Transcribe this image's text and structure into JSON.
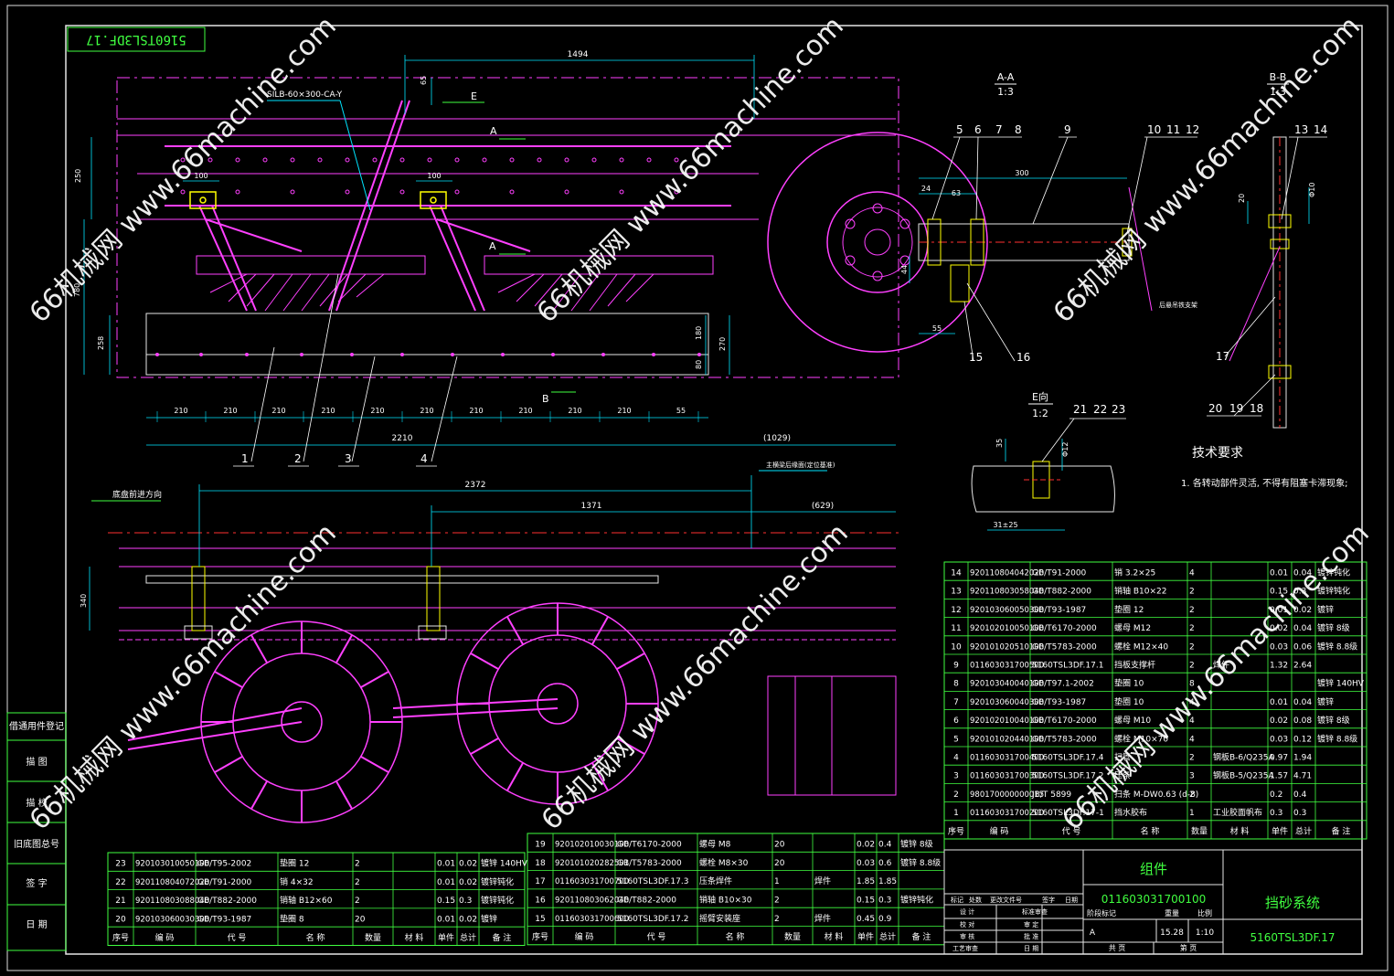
{
  "drawing_code_rotated": "5160TSL3DF.17",
  "dimensions": {
    "d1494": "1494",
    "d65": "65",
    "d250": "250",
    "d780": "780",
    "d258": "258",
    "d100a": "100",
    "d100b": "100",
    "d180": "180",
    "d270": "270",
    "d80": "80",
    "d210": "210",
    "d55": "55",
    "d2210": "2210",
    "d1029": "(1029)",
    "d2372": "2372",
    "d1371": "1371",
    "d629": "(629)",
    "d340": "340",
    "d300": "300",
    "d24": "24",
    "d63": "63",
    "d20": "20",
    "d10": "Φ10",
    "d44": "44",
    "d55b": "55",
    "d35": "35",
    "d12": "Φ12",
    "d31": "31±25"
  },
  "labels": {
    "part_code": "SILB-60×300-CA-Y",
    "E": "E",
    "A": "A",
    "A2": "A",
    "B": "B",
    "chassis_dir": "底盘前进方向",
    "frame_note": "主横梁后缘面(定位基准)",
    "support_note": "后悬吊铁支架"
  },
  "callouts": [
    "1",
    "2",
    "3",
    "4",
    "5",
    "6",
    "7",
    "8",
    "9",
    "10",
    "11",
    "12",
    "13",
    "14",
    "15",
    "16",
    "17",
    "18",
    "19",
    "20",
    "21",
    "22",
    "23"
  ],
  "views": {
    "aa_title": "A-A",
    "aa_scale": "1:3",
    "bb_title": "B-B",
    "bb_scale": "1:3",
    "e_title": "E向",
    "e_scale": "1:2"
  },
  "tech": {
    "title": "技术要求",
    "note1": "1. 各转动部件灵活, 不得有阻塞卡滞现象;"
  },
  "left_strip": [
    "借通用件登记",
    "描 图",
    "描 校",
    "旧底图总号",
    "签 字",
    "日 期"
  ],
  "bom_headers": {
    "seq": "序号",
    "code": "编 码",
    "std": "代 号",
    "name": "名 称",
    "qty": "数量",
    "mat": "材 料",
    "unit_w": "单件",
    "total_w": "总计",
    "weight": "重 量",
    "note": "备 注"
  },
  "bom_right": [
    [
      "14",
      "920110804042020",
      "GB/T91-2000",
      "销 3.2×25",
      "4",
      "",
      "0.01",
      "0.04",
      "镀锌钝化"
    ],
    [
      "13",
      "920110803058040",
      "GB/T882-2000",
      "销轴 B10×22",
      "2",
      "",
      "0.15",
      "0.3",
      "镀锌钝化"
    ],
    [
      "12",
      "920103060050300",
      "GB/T93-1987",
      "垫圈 12",
      "2",
      "",
      "0.01",
      "0.02",
      "镀锌"
    ],
    [
      "11",
      "920102010050100",
      "GB/T6170-2000",
      "螺母 M12",
      "2",
      "",
      "0.02",
      "0.04",
      "镀锌 8级"
    ],
    [
      "10",
      "920101020510100",
      "GB/T5783-2000",
      "螺栓 M12×40",
      "2",
      "",
      "0.03",
      "0.06",
      "镀锌 8.8级"
    ],
    [
      "9",
      "011603031700500",
      "5160TSL3DF.17.1",
      "挡板支撑杆",
      "2",
      "焊件",
      "1.32",
      "2.64",
      ""
    ],
    [
      "8",
      "920103040040100",
      "GB/T97.1-2002",
      "垫圈 10",
      "8",
      "",
      "",
      "",
      "镀锌 140HV"
    ],
    [
      "7",
      "920103060040300",
      "GB/T93-1987",
      "垫圈 10",
      "4",
      "",
      "0.01",
      "0.04",
      "镀锌"
    ],
    [
      "6",
      "920102010040100",
      "GB/T6170-2000",
      "螺母 M10",
      "4",
      "",
      "0.02",
      "0.08",
      "镀锌 8级"
    ],
    [
      "5",
      "920101020440100",
      "GB/T5783-2000",
      "螺栓 M10×70",
      "4",
      "",
      "0.03",
      "0.12",
      "镀锌 8.8级"
    ],
    [
      "4",
      "011603031700400",
      "5160TSL3DF.17.4",
      "扫管",
      "2",
      "钢板B-6/Q235A",
      "0.97",
      "1.94",
      ""
    ],
    [
      "3",
      "011603031700300",
      "5160TSL3DF.17.2",
      "压条",
      "3",
      "钢板B-5/Q235A",
      "1.57",
      "4.71",
      ""
    ],
    [
      "2",
      "980170000000015",
      "JB/T 5899",
      "扫条 M-DW0.63 (d-8)",
      "2",
      "",
      "0.2",
      "0.4",
      ""
    ],
    [
      "1",
      "011603031700200",
      "5160TSL3DF.17-1",
      "挡水胶布",
      "1",
      "工业胶面帆布",
      "0.3",
      "0.3",
      ""
    ]
  ],
  "bom_left": [
    [
      "23",
      "920103010050100",
      "GB/T95-2002",
      "垫圈 12",
      "2",
      "",
      "0.01",
      "0.02",
      "镀锌 140HV"
    ],
    [
      "22",
      "920110804072020",
      "GB/T91-2000",
      "销 4×32",
      "2",
      "",
      "0.01",
      "0.02",
      "镀锌钝化"
    ],
    [
      "21",
      "920110803088040",
      "GB/T882-2000",
      "销轴 B12×60",
      "2",
      "",
      "0.15",
      "0.3",
      "镀锌钝化"
    ],
    [
      "20",
      "920103060030300",
      "GB/T93-1987",
      "垫圈 8",
      "20",
      "",
      "0.01",
      "0.02",
      "镀锌"
    ]
  ],
  "bom_mid": [
    [
      "19",
      "920102010030100",
      "GB/T6170-2000",
      "螺母 M8",
      "20",
      "",
      "0.02",
      "0.4",
      "镀锌 8级"
    ],
    [
      "18",
      "920101020282501",
      "GB/T5783-2000",
      "螺栓 M8×30",
      "20",
      "",
      "0.03",
      "0.6",
      "镀锌 8.8级"
    ],
    [
      "17",
      "011603031700700",
      "5160TSL3DF.17.3",
      "压条焊件",
      "1",
      "焊件",
      "1.85",
      "1.85",
      ""
    ],
    [
      "16",
      "920110803062040",
      "GB/T882-2000",
      "销轴 B10×30",
      "2",
      "",
      "0.15",
      "0.3",
      "镀锌钝化"
    ],
    [
      "15",
      "011603031700600",
      "5160TSL3DF.17.2",
      "摇臂安装座",
      "2",
      "焊件",
      "0.45",
      "0.9",
      ""
    ]
  ],
  "title_block": {
    "assembly": "组件",
    "code": "011603031700100",
    "name": "挡砂系统",
    "drawing_no": "5160TSL3DF.17",
    "weight": "15.28",
    "scale": "1:10",
    "stage": "A",
    "rows": [
      "标记",
      "处数",
      "更改文件号",
      "签字",
      "日期"
    ],
    "sign": [
      "设 计",
      "校 对",
      "审 核",
      "工艺审查"
    ],
    "sign2": [
      "标准审查",
      "审 定",
      "批 准",
      "日 期"
    ],
    "stage_hdr": [
      "阶段标记",
      "重量",
      "比例"
    ],
    "sheets": [
      "共 页",
      "第 页"
    ]
  },
  "watermarks": [
    "66机械网 www.66machine.com",
    "66机械网 www.66machine.com",
    "66机械网 www.66machine.com",
    "66机械网 www.66machine.com",
    "66机械网 www.66machine.com",
    "66机械网 www.66machine.com"
  ],
  "colors": {
    "background": "#000000",
    "frame": "#e6e6e6",
    "magenta": "#ff40ff",
    "green": "#40ff40",
    "cyan": "#00e5ff",
    "yellow": "#ffff00",
    "red": "#ff3030",
    "white": "#ffffff"
  }
}
